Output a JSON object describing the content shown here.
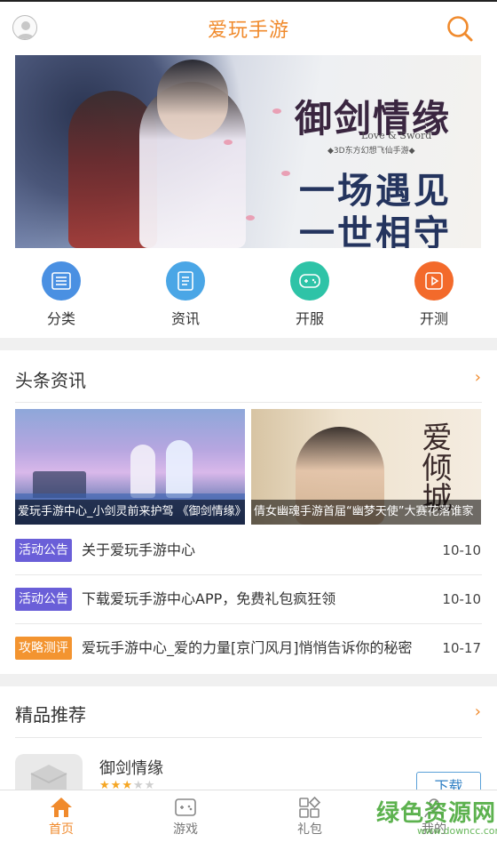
{
  "header": {
    "title": "爱玩手游",
    "avatar_icon": "user-avatar-icon",
    "search_icon": "search-icon"
  },
  "banner": {
    "logo": "御剑情缘",
    "logo_en": "Love & Sword",
    "logo_sub": "◆3D东方幻想飞仙手游◆",
    "slogan_line1": "一场遇见",
    "slogan_line2": "一世相守"
  },
  "quick_nav": [
    {
      "label": "分类",
      "icon": "list-icon",
      "color": "#4a90e2"
    },
    {
      "label": "资讯",
      "icon": "document-icon",
      "color": "#4aa6e6"
    },
    {
      "label": "开服",
      "icon": "gamepad-icon",
      "color": "#2ec3a7"
    },
    {
      "label": "开测",
      "icon": "play-icon",
      "color": "#f36a2b"
    }
  ],
  "headlines": {
    "title": "头条资讯",
    "more": "›",
    "cards": [
      {
        "caption": "爱玩手游中心_小剑灵前来护驾 《御剑情缘》"
      },
      {
        "caption": "倩女幽魂手游首届“幽梦天使”大赛花落谁家"
      }
    ],
    "items": [
      {
        "tag": "活动公告",
        "tag_color": "#6a5fd8",
        "title": "关于爱玩手游中心",
        "date": "10-10"
      },
      {
        "tag": "活动公告",
        "tag_color": "#6a5fd8",
        "title": "下载爱玩手游中心APP，免费礼包疯狂领",
        "date": "10-10"
      },
      {
        "tag": "攻略测评",
        "tag_color": "#f39430",
        "title": "爱玩手游中心_爱的力量[京门风月]悄悄告诉你的秘密",
        "date": "10-17"
      }
    ]
  },
  "recommend": {
    "title": "精品推荐",
    "more": "›",
    "items": [
      {
        "name": "御剑情缘",
        "rating": 3,
        "max_rating": 5,
        "button": "下载"
      }
    ]
  },
  "tabbar": [
    {
      "label": "首页",
      "icon": "home-icon",
      "active": true
    },
    {
      "label": "游戏",
      "icon": "gamepad-icon",
      "active": false
    },
    {
      "label": "礼包",
      "icon": "gift-grid-icon",
      "active": false
    },
    {
      "label": "我的",
      "icon": "user-icon",
      "active": false
    }
  ],
  "watermark": {
    "text": "绿色资源网",
    "sub": "www.downcc.com"
  },
  "colors": {
    "accent": "#f08a2c",
    "tag_purple": "#6a5fd8",
    "tag_orange": "#f39430"
  }
}
